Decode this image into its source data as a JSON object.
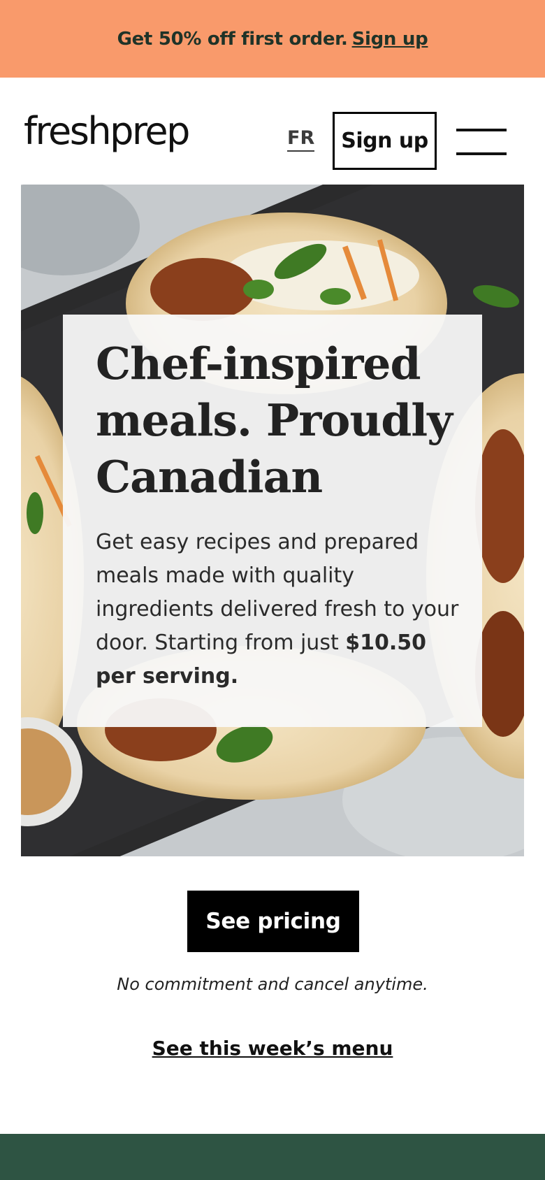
{
  "promo": {
    "text": "Get 50% off first order.",
    "link_label": "Sign up"
  },
  "header": {
    "logo_text": "freshprep",
    "language_label": "FR",
    "signup_label": "Sign up",
    "menu_icon": "hamburger-menu-icon"
  },
  "hero": {
    "image": "tacos-on-slate-board-photo",
    "headline": "Chef-inspired meals. Proudly Canadian⁠",
    "subtext": "Get easy recipes and prepared meals made with quality ingredients delivered fresh to your door. Starting from just ",
    "price_text": "$10.50 per serving."
  },
  "cta": {
    "pricing_label": "See pricing",
    "note": "No commitment and cancel anytime.",
    "menu_link": "See this week’s menu"
  },
  "colors": {
    "promo_bg": "#f99a6b",
    "promo_text": "#1f3328",
    "button_bg": "#000000",
    "footer_bg": "#2e5443"
  }
}
